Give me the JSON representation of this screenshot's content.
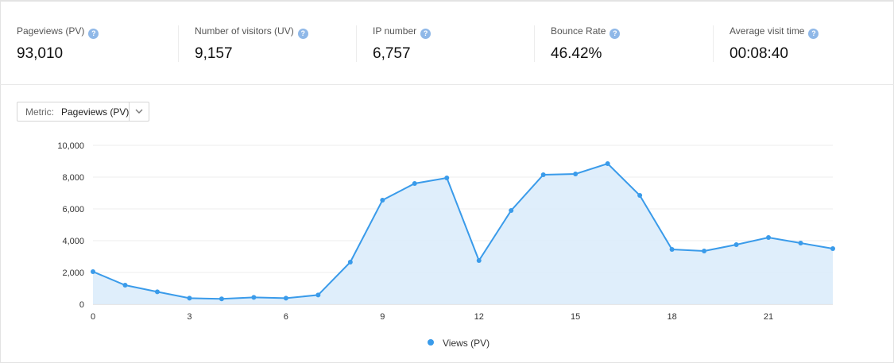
{
  "stats": [
    {
      "label": "Pageviews (PV)",
      "value": "93,010"
    },
    {
      "label": "Number of visitors (UV)",
      "value": "9,157"
    },
    {
      "label": "IP number",
      "value": "6,757"
    },
    {
      "label": "Bounce Rate",
      "value": "46.42%"
    },
    {
      "label": "Average visit time",
      "value": "00:08:40"
    }
  ],
  "help_glyph": "?",
  "metric_select": {
    "label": "Metric:",
    "value": "Pageviews (PV)"
  },
  "colors": {
    "accent": "#3a9bea",
    "area": "#dcecfb",
    "help": "#8fb8e8"
  },
  "chart_data": {
    "type": "area",
    "x": [
      0,
      1,
      2,
      3,
      4,
      5,
      6,
      7,
      8,
      9,
      10,
      11,
      12,
      13,
      14,
      15,
      16,
      17,
      18,
      19,
      20,
      21,
      22,
      23
    ],
    "series": [
      {
        "name": "Views (PV)",
        "values": [
          2050,
          1200,
          780,
          380,
          340,
          430,
          380,
          580,
          2650,
          6550,
          7600,
          7950,
          2750,
          5900,
          8150,
          8200,
          8850,
          6850,
          3450,
          3350,
          3750,
          4200,
          3850,
          3500
        ]
      }
    ],
    "xticks": [
      0,
      3,
      6,
      9,
      12,
      15,
      18,
      21
    ],
    "yticks": [
      0,
      2000,
      4000,
      6000,
      8000,
      10000
    ],
    "ytick_labels": [
      "0",
      "2,000",
      "4,000",
      "6,000",
      "8,000",
      "10,000"
    ],
    "ylim": [
      0,
      10000
    ],
    "xlim": [
      0,
      23
    ],
    "grid": true,
    "legend_position": "bottom-center"
  }
}
